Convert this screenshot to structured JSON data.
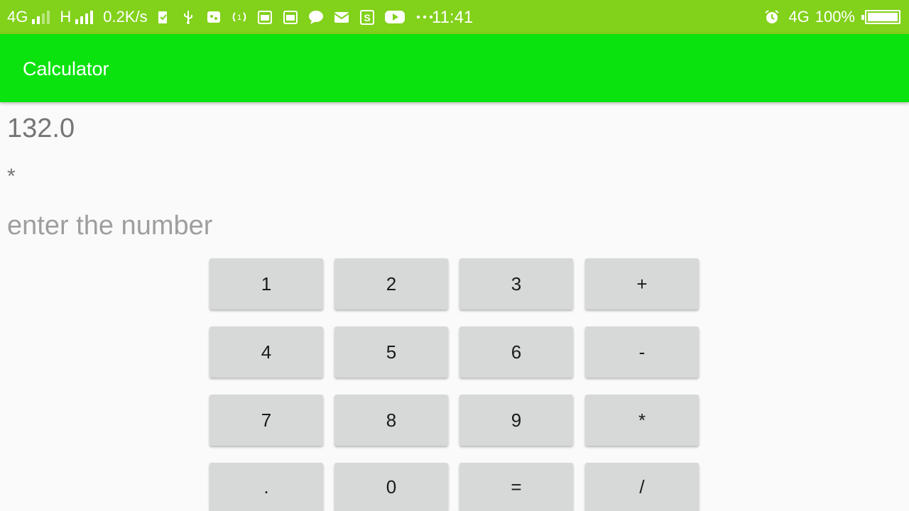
{
  "status_bar": {
    "network_1": "4G",
    "network_2": "H",
    "speed": "0.2K/s",
    "time": "11:41",
    "network_right": "4G",
    "battery": "100%",
    "icons": [
      "check-battery-icon",
      "usb-icon",
      "sim-icon",
      "hotspot-icon",
      "calendar-icon",
      "calendar-icon",
      "chat-icon",
      "mail-icon",
      "s-app-icon",
      "youtube-icon",
      "more-icon",
      "alarm-icon"
    ]
  },
  "app_bar": {
    "title": "Calculator"
  },
  "display": {
    "result": "132.0",
    "operator": "*",
    "input_placeholder": "enter the number",
    "input_value": ""
  },
  "keypad": {
    "rows": [
      [
        "1",
        "2",
        "3",
        "+"
      ],
      [
        "4",
        "5",
        "6",
        "-"
      ],
      [
        "7",
        "8",
        "9",
        "*"
      ],
      [
        ".",
        "0",
        "=",
        "/"
      ]
    ]
  },
  "colors": {
    "status_bar": "#82d11a",
    "app_bar": "#0be30e",
    "button": "#d7d8d8",
    "background": "#fafafa"
  }
}
